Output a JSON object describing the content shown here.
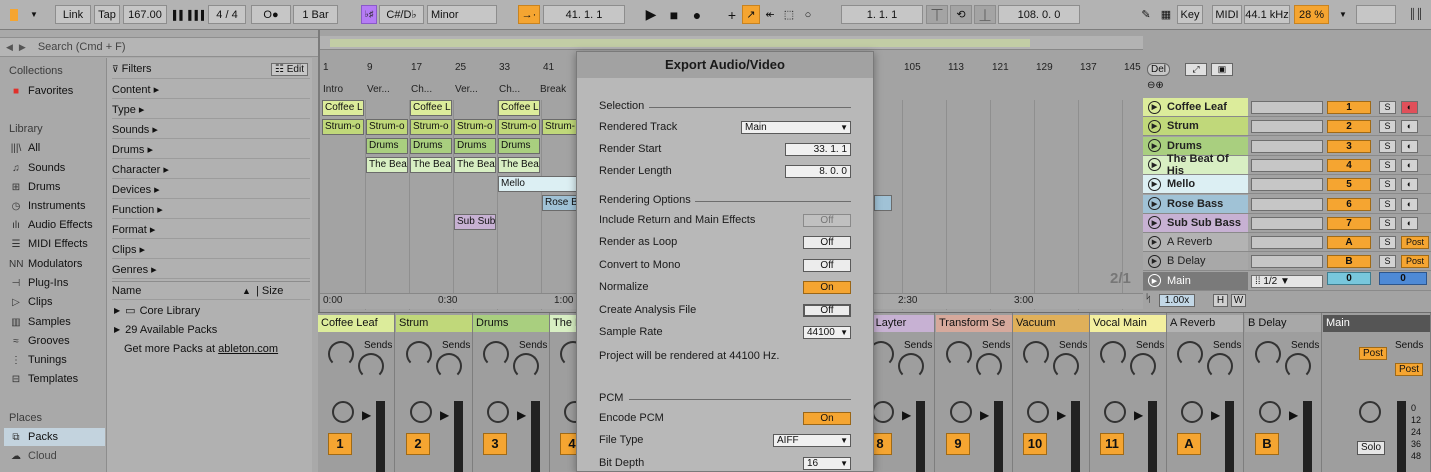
{
  "topbar": {
    "link": "Link",
    "tap": "Tap",
    "tempo": "167.00",
    "signature": "4 / 4",
    "metro": "O●",
    "quantize": "1 Bar",
    "key_root": "C#/D♭",
    "scale": "Minor",
    "arrangement_position": "41.  1.  1",
    "loop_start": "1.  1.  1",
    "loop_length": "108.  0.  0",
    "key_label": "Key",
    "midi_label": "MIDI",
    "sample_rate": "44.1 kHz",
    "cpu": "28 %"
  },
  "browser": {
    "search_placeholder": "Search (Cmd + F)",
    "collections_header": "Collections",
    "favorites": "Favorites",
    "library_header": "Library",
    "library_items": [
      "All",
      "Sounds",
      "Drums",
      "Instruments",
      "Audio Effects",
      "MIDI Effects",
      "Modulators",
      "Plug-Ins",
      "Clips",
      "Samples",
      "Grooves",
      "Tunings",
      "Templates"
    ],
    "places_header": "Places",
    "places_items": [
      "Packs",
      "Cloud"
    ],
    "filters_label": "Filters",
    "edit_label": "Edit",
    "filter_items": [
      "Content ▸",
      "Type ▸",
      "Sounds ▸",
      "Drums ▸",
      "Character ▸",
      "Devices ▸",
      "Function ▸",
      "Format ▸",
      "Clips ▸",
      "Genres ▸"
    ],
    "col_name": "Name",
    "col_size": "Size",
    "rows": [
      "Core Library",
      "29 Available Packs"
    ],
    "get_more": "Get more Packs at",
    "get_more_link": "ableton.com"
  },
  "arrangement": {
    "ruler": [
      "1",
      "9",
      "17",
      "25",
      "33",
      "41",
      "105",
      "113",
      "121",
      "129",
      "137",
      "145"
    ],
    "locators": [
      "Intro",
      "Ver...",
      "Ch...",
      "Ver...",
      "Ch...",
      "Break"
    ],
    "time": [
      "0:00",
      "0:30",
      "1:00",
      "2:30",
      "3:00"
    ],
    "zoom_counter": "2/1",
    "clips": {
      "coffee": [
        "Coffee L",
        "Coffee L",
        "Coffee L"
      ],
      "strum": [
        "Strum-o",
        "Strum-o",
        "Strum-o",
        "Strum-o",
        "Strum-o",
        "Strum-"
      ],
      "drums": [
        "Drums",
        "Drums",
        "Drums",
        "Drums"
      ],
      "beat": [
        "The Beat",
        "The Beat",
        "The Beat",
        "The Beat"
      ],
      "mello": "Mello",
      "rose": "Rose Ba",
      "subsub": "Sub Sub"
    }
  },
  "tracks": {
    "del": "Del",
    "names": [
      "Coffee Leaf",
      "Strum",
      "Drums",
      "The Beat Of His",
      "Mello",
      "Rose Bass",
      "Sub Sub Bass",
      "A Reverb",
      "B Delay",
      "Main"
    ],
    "numbers": [
      "1",
      "2",
      "3",
      "4",
      "5",
      "6",
      "7",
      "A",
      "B",
      "0"
    ],
    "solo": "S",
    "post": "Post",
    "main_ratio": "1/2",
    "zoom": "1.00x",
    "h": "H",
    "w": "W",
    "colors": [
      "#dcec9b",
      "#c0d87a",
      "#a9cf7f",
      "#d8efc3",
      "#dceff3",
      "#a0c2d6",
      "#c7b1d3",
      "#b3b3b3",
      "#a8a8a8",
      "#7a7a7a"
    ]
  },
  "mixer": {
    "channels": [
      "Coffee Leaf",
      "Strum",
      "Drums",
      "The B",
      "",
      "uit Layter",
      "Transform Se",
      "Vacuum",
      "Vocal Main",
      "A Reverb",
      "B Delay",
      "Main"
    ],
    "numbers": [
      "1",
      "2",
      "3",
      "4",
      "",
      "8",
      "9",
      "10",
      "11",
      "A",
      "B"
    ],
    "sends": "Sends",
    "post": "Post",
    "solo": "Solo",
    "db": [
      "0",
      "12",
      "24",
      "36",
      "48"
    ]
  },
  "dialog": {
    "title": "Export Audio/Video",
    "selection": "Selection",
    "rendered_track_label": "Rendered Track",
    "rendered_track": "Main",
    "render_start_label": "Render Start",
    "render_start": "33.  1.  1",
    "render_length_label": "Render Length",
    "render_length": "8.  0.  0",
    "rendering_options": "Rendering Options",
    "include_label": "Include Return and Main Effects",
    "include": "Off",
    "loop_label": "Render as Loop",
    "loop": "Off",
    "mono_label": "Convert to Mono",
    "mono": "Off",
    "normalize_label": "Normalize",
    "normalize": "On",
    "analysis_label": "Create Analysis File",
    "analysis": "Off",
    "sample_rate_label": "Sample Rate",
    "sample_rate": "44100",
    "info": "Project will be rendered at 44100 Hz.",
    "pcm": "PCM",
    "encode_label": "Encode PCM",
    "encode": "On",
    "filetype_label": "File Type",
    "filetype": "AIFF",
    "bitdepth_label": "Bit Depth",
    "bitdepth": "16"
  }
}
